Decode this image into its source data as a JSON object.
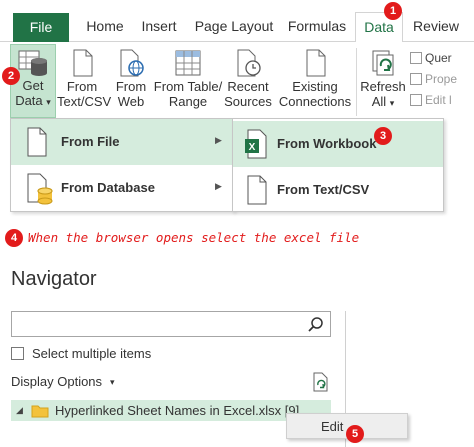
{
  "ribbon_tabs": {
    "file": "File",
    "home": "Home",
    "insert": "Insert",
    "page_layout": "Page Layout",
    "formulas": "Formulas",
    "data": "Data",
    "review": "Review"
  },
  "ribbon_buttons": {
    "get_data_line1": "Get",
    "get_data_line2": "Data",
    "get_data_caret": "▾",
    "from_text_line1": "From",
    "from_text_line2": "Text/CSV",
    "from_web_line1": "From",
    "from_web_line2": "Web",
    "from_table_line1": "From Table/",
    "from_table_line2": "Range",
    "recent_line1": "Recent",
    "recent_line2": "Sources",
    "existing_line1": "Existing",
    "existing_line2": "Connections",
    "refresh_line1": "Refresh",
    "refresh_line2": "All",
    "refresh_caret": "▾",
    "queries": "Quer",
    "properties": "Prope",
    "edit_links": "Edit l"
  },
  "get_data_menu": {
    "from_file": "From File",
    "from_database": "From Database",
    "submenu_arrow": "▶"
  },
  "from_file_submenu": {
    "from_workbook": "From Workbook",
    "from_text_csv": "From Text/CSV"
  },
  "badges": [
    "1",
    "2",
    "3",
    "4",
    "5"
  ],
  "instruction": "When the browser opens select the excel file",
  "navigator": {
    "title": "Navigator",
    "search_value": "",
    "select_multiple": "Select multiple items",
    "display_options": "Display Options",
    "caret": "▾",
    "tree_toggle": "◢",
    "tree_item": "Hyperlinked Sheet Names in Excel.xlsx [9]",
    "context_edit": "Edit"
  },
  "colors": {
    "excel_green": "#217346",
    "highlight": "#d5ecdd",
    "badge_red": "#e21b1b"
  }
}
